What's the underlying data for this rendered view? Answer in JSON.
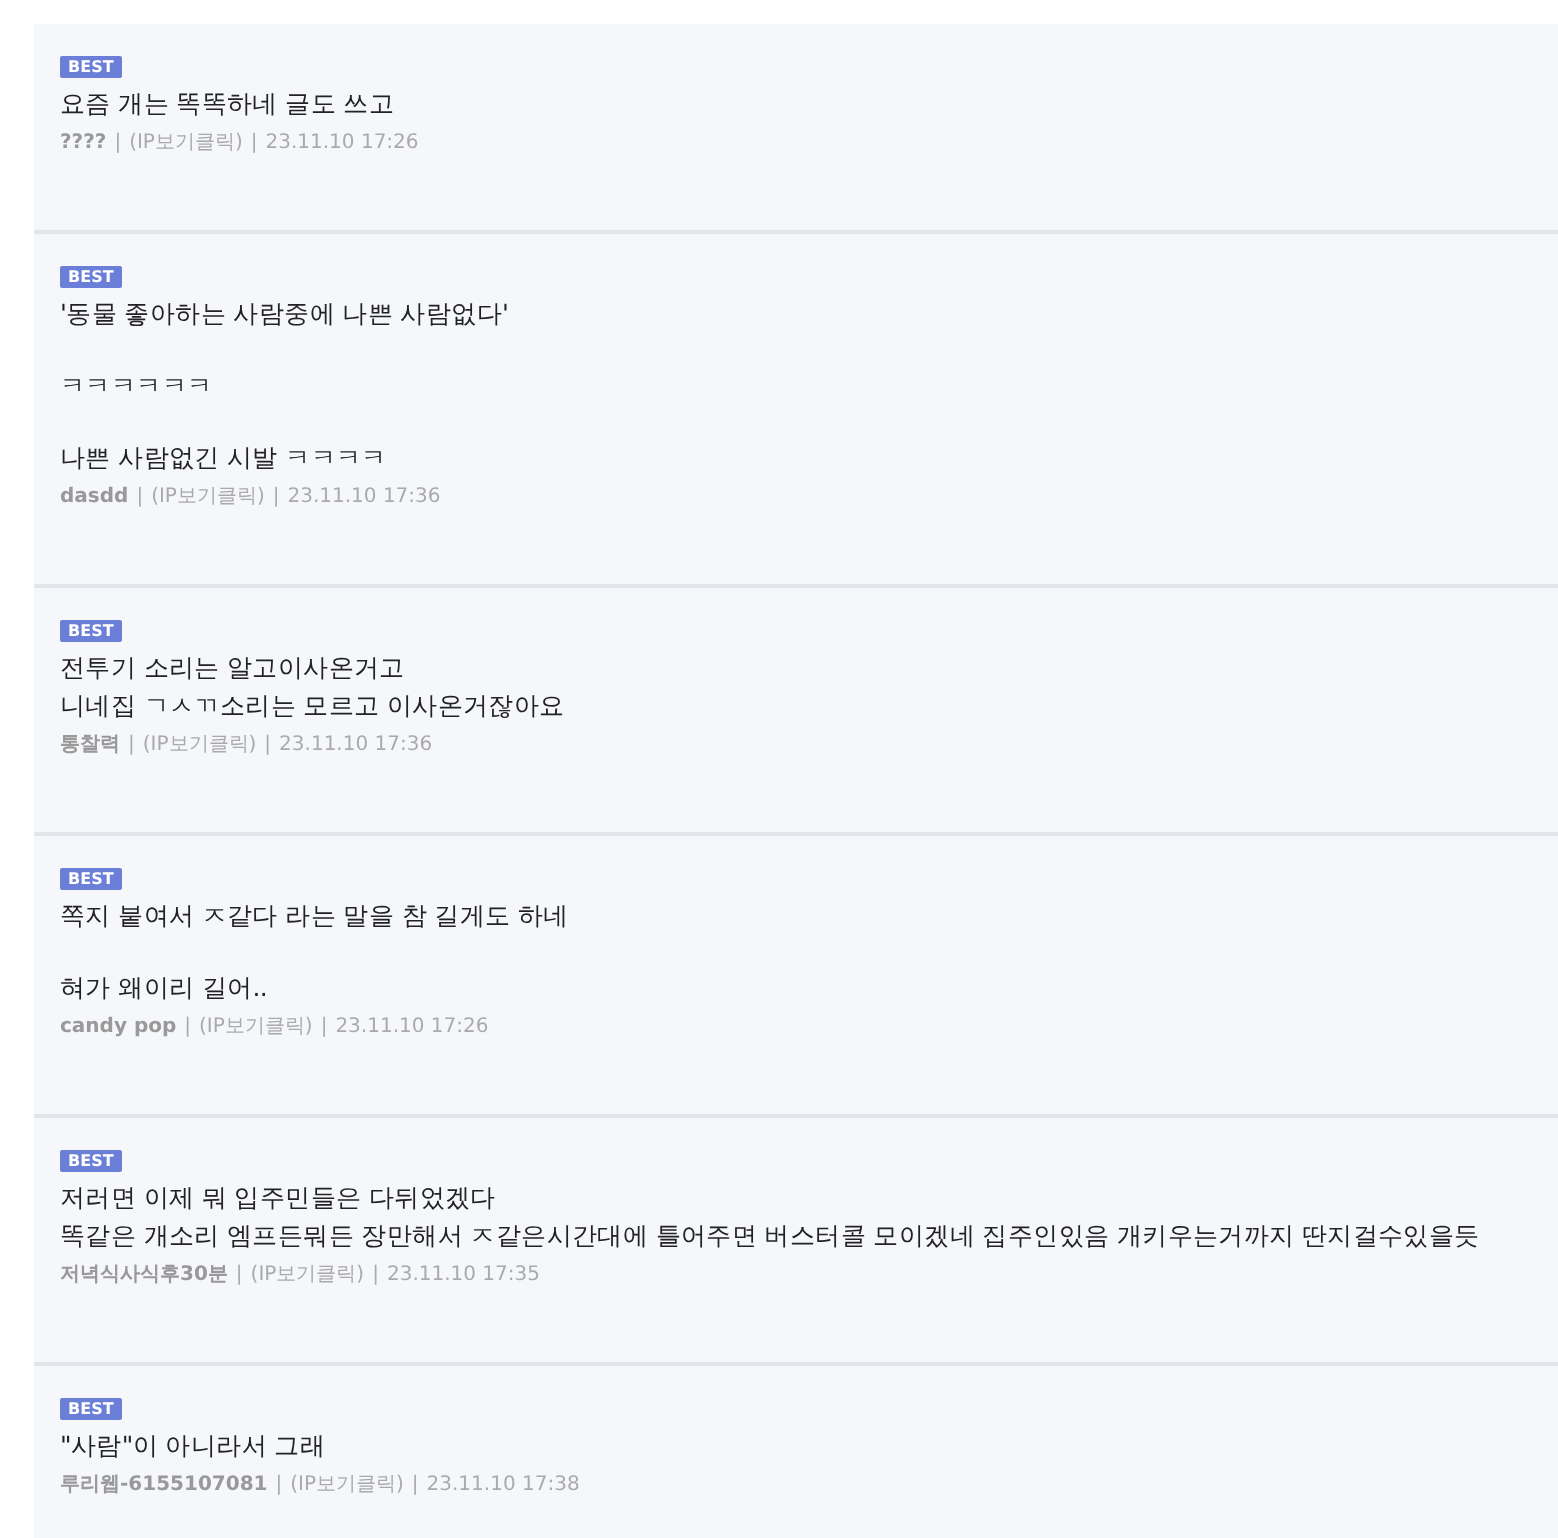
{
  "comments": [
    {
      "badge": "BEST",
      "paragraphs": [
        [
          "요즘 개는 똑똑하네 글도 쓰고"
        ]
      ],
      "author": "????",
      "separator_1": "|",
      "ip_link": "(IP보기클릭)",
      "separator_2": "|",
      "date": "23.11.10 17:26"
    },
    {
      "badge": "BEST",
      "paragraphs": [
        [
          "'동물 좋아하는 사람중에 나쁜 사람없다'"
        ],
        [
          "ㅋㅋㅋㅋㅋㅋ"
        ],
        [
          "나쁜 사람없긴 시발 ㅋㅋㅋㅋ"
        ]
      ],
      "author": "dasdd",
      "separator_1": "|",
      "ip_link": "(IP보기클릭)",
      "separator_2": "|",
      "date": "23.11.10 17:36"
    },
    {
      "badge": "BEST",
      "paragraphs": [
        [
          "전투기 소리는 알고이사온거고",
          "니네집 ㄱㅅㄲ소리는 모르고 이사온거잖아요"
        ]
      ],
      "author": "통찰력",
      "separator_1": "|",
      "ip_link": "(IP보기클릭)",
      "separator_2": "|",
      "date": "23.11.10 17:36"
    },
    {
      "badge": "BEST",
      "paragraphs": [
        [
          "쪽지 붙여서 ㅈ같다 라는 말을 참 길게도 하네"
        ],
        [
          "혀가 왜이리 길어.."
        ]
      ],
      "author": "candy pop",
      "separator_1": "|",
      "ip_link": "(IP보기클릭)",
      "separator_2": "|",
      "date": "23.11.10 17:26"
    },
    {
      "badge": "BEST",
      "paragraphs": [
        [
          "저러면 이제 뭐 입주민들은 다뒤었겠다",
          "똑같은 개소리 엠프든뭐든 장만해서 ㅈ같은시간대에 틀어주면 버스터콜 모이겠네 집주인있음 개키우는거까지 딴지걸수있을듯"
        ]
      ],
      "author": "저녁식사식후30분",
      "separator_1": "|",
      "ip_link": "(IP보기클릭)",
      "separator_2": "|",
      "date": "23.11.10 17:35"
    },
    {
      "badge": "BEST",
      "paragraphs": [
        [
          "\"사람\"이 아니라서 그래"
        ]
      ],
      "author": "루리웹-6155107081",
      "separator_1": "|",
      "ip_link": "(IP보기클릭)",
      "separator_2": "|",
      "date": "23.11.10 17:38"
    }
  ]
}
